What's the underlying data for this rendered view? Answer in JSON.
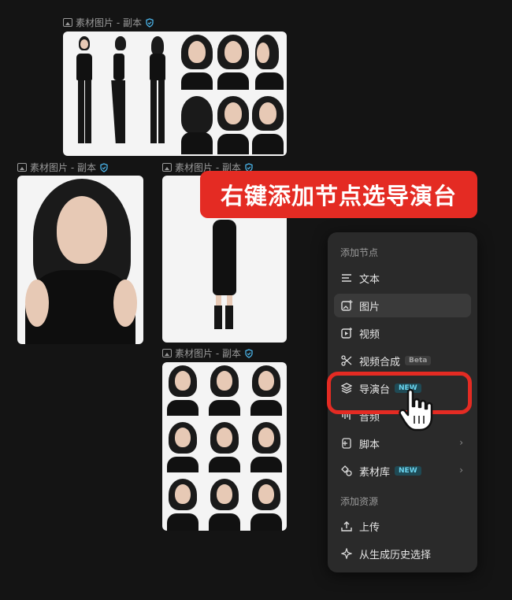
{
  "nodes": [
    {
      "label": "素材图片 - 副本"
    },
    {
      "label": "素材图片 - 副本"
    },
    {
      "label": "素材图片 - 副本"
    },
    {
      "label": "素材图片 - 副本"
    }
  ],
  "callout": {
    "text": "右键添加节点选导演台",
    "color": "#e42b23"
  },
  "menu": {
    "section_add_node": "添加节点",
    "items": [
      {
        "label": "文本",
        "icon": "text-lines-icon"
      },
      {
        "label": "图片",
        "icon": "image-plus-icon"
      },
      {
        "label": "视频",
        "icon": "video-icon"
      },
      {
        "label": "视频合成",
        "icon": "scissors-icon",
        "badge": "Beta"
      },
      {
        "label": "导演台",
        "icon": "layers-icon",
        "badge": "NEW"
      },
      {
        "label": "音频",
        "icon": "audio-icon"
      },
      {
        "label": "脚本",
        "icon": "script-icon"
      },
      {
        "label": "素材库",
        "icon": "asset-library-icon",
        "badge": "NEW"
      }
    ],
    "section_add_resource": "添加资源",
    "upload": "上传",
    "select_history": "从生成历史选择"
  },
  "colors": {
    "badge_new": "#6ad4ef",
    "accent_red": "#e42b23",
    "menu_bg": "#2a2a2a"
  }
}
